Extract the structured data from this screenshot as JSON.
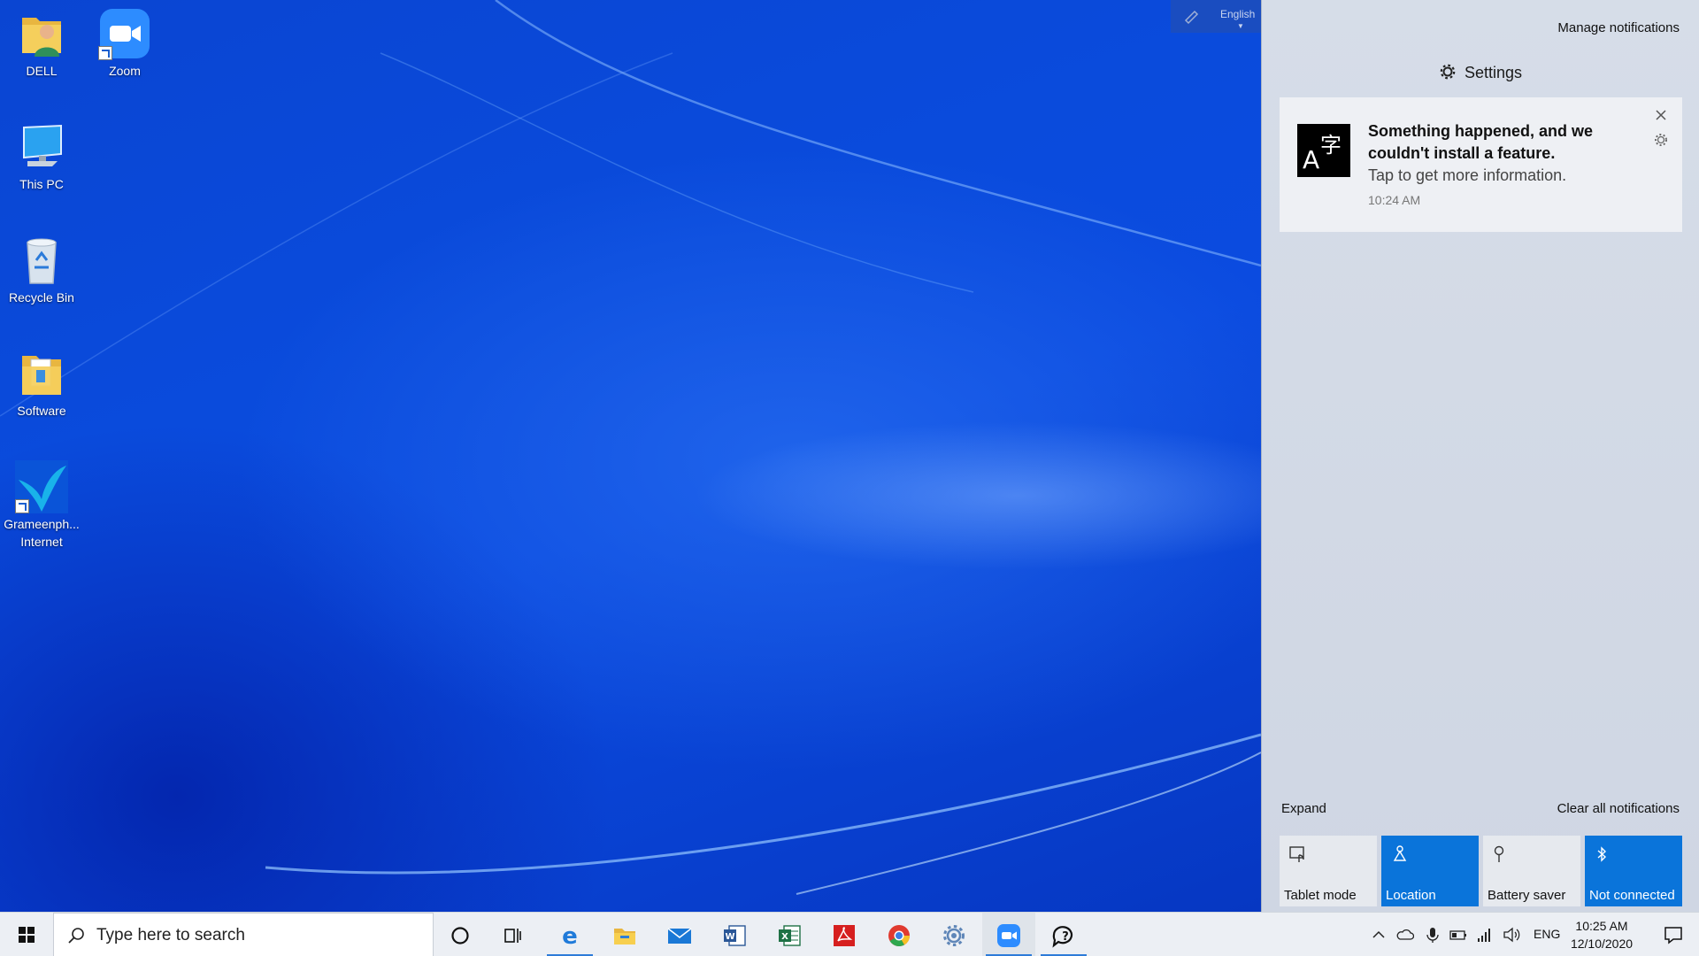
{
  "desktop": {
    "icons": [
      {
        "label": "DELL"
      },
      {
        "label": "Zoom"
      },
      {
        "label": "This PC"
      },
      {
        "label": "Recycle Bin"
      },
      {
        "label": "Software"
      },
      {
        "label": "Grameenph...\nInternet"
      }
    ],
    "language_pill": {
      "label": "English"
    }
  },
  "action_center": {
    "manage_notifications": "Manage notifications",
    "group_title": "Settings",
    "notification": {
      "title": "Something happened, and we couldn't install a feature.",
      "body": "Tap to get more information.",
      "time": "10:24 AM"
    },
    "expand": "Expand",
    "clear_all": "Clear all notifications",
    "quick_actions": [
      {
        "label": "Tablet mode",
        "state": "off",
        "icon": "tablet-mode-icon"
      },
      {
        "label": "Location",
        "state": "on",
        "icon": "location-icon"
      },
      {
        "label": "Battery saver",
        "state": "off",
        "icon": "battery-saver-icon"
      },
      {
        "label": "Not connected",
        "state": "on",
        "icon": "bluetooth-icon"
      }
    ]
  },
  "taskbar": {
    "search_placeholder": "Type here to search",
    "pinned": [
      {
        "name": "edge",
        "icon": "edge-icon",
        "active": true
      },
      {
        "name": "file-explorer",
        "icon": "folder-icon",
        "active": false
      },
      {
        "name": "mail",
        "icon": "mail-icon",
        "active": false
      },
      {
        "name": "word",
        "icon": "word-icon",
        "active": false
      },
      {
        "name": "excel",
        "icon": "excel-icon",
        "active": false
      },
      {
        "name": "acrobat",
        "icon": "pdf-icon",
        "active": false
      },
      {
        "name": "chrome",
        "icon": "chrome-icon",
        "active": false
      },
      {
        "name": "settings-gear",
        "icon": "gear-app-icon",
        "active": false
      },
      {
        "name": "zoom",
        "icon": "zoom-icon",
        "active": true
      },
      {
        "name": "feedback",
        "icon": "feedback-hub-icon",
        "active": true
      }
    ],
    "tray": {
      "language": "ENG",
      "time": "10:25 AM",
      "date": "12/10/2020"
    }
  },
  "colors": {
    "accent": "#0a74da",
    "wallpaper": "#0b4be0",
    "action_center_bg": "#d6dde8",
    "taskbar_bg": "#eceff4"
  }
}
